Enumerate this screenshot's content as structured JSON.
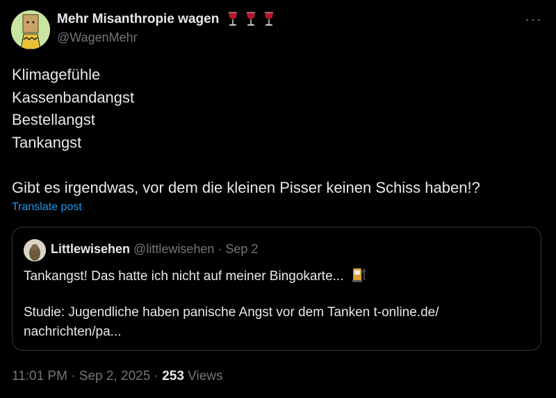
{
  "tweet": {
    "display_name": "Mehr Misanthropie wagen",
    "handle": "@WagenMehr",
    "lines": [
      "Klimagefühle",
      "Kassenbandangst",
      "Bestellangst",
      "Tankangst"
    ],
    "question": "Gibt es irgendwas, vor dem die kleinen Pisser keinen Schiss haben!?",
    "translate_label": "Translate post"
  },
  "quote": {
    "display_name": "Littlewisehen",
    "handle": "@littlewisehen",
    "separator": " · ",
    "date": "Sep 2",
    "line1": "Tankangst! Das hatte ich nicht auf meiner Bingokarte...",
    "line2": "Studie: Jugendliche haben panische Angst vor dem Tanken t-online.de/",
    "line3": "nachrichten/pa..."
  },
  "footer": {
    "time": "11:01 PM",
    "sep1": " · ",
    "date": "Sep 2, 2025",
    "sep2": " · ",
    "views_count": "253",
    "views_label": "Views"
  },
  "icons": {
    "header_emoji": "wine-glass-icon",
    "quote_emoji": "fuel-pump-icon",
    "more": "more-options-icon"
  }
}
